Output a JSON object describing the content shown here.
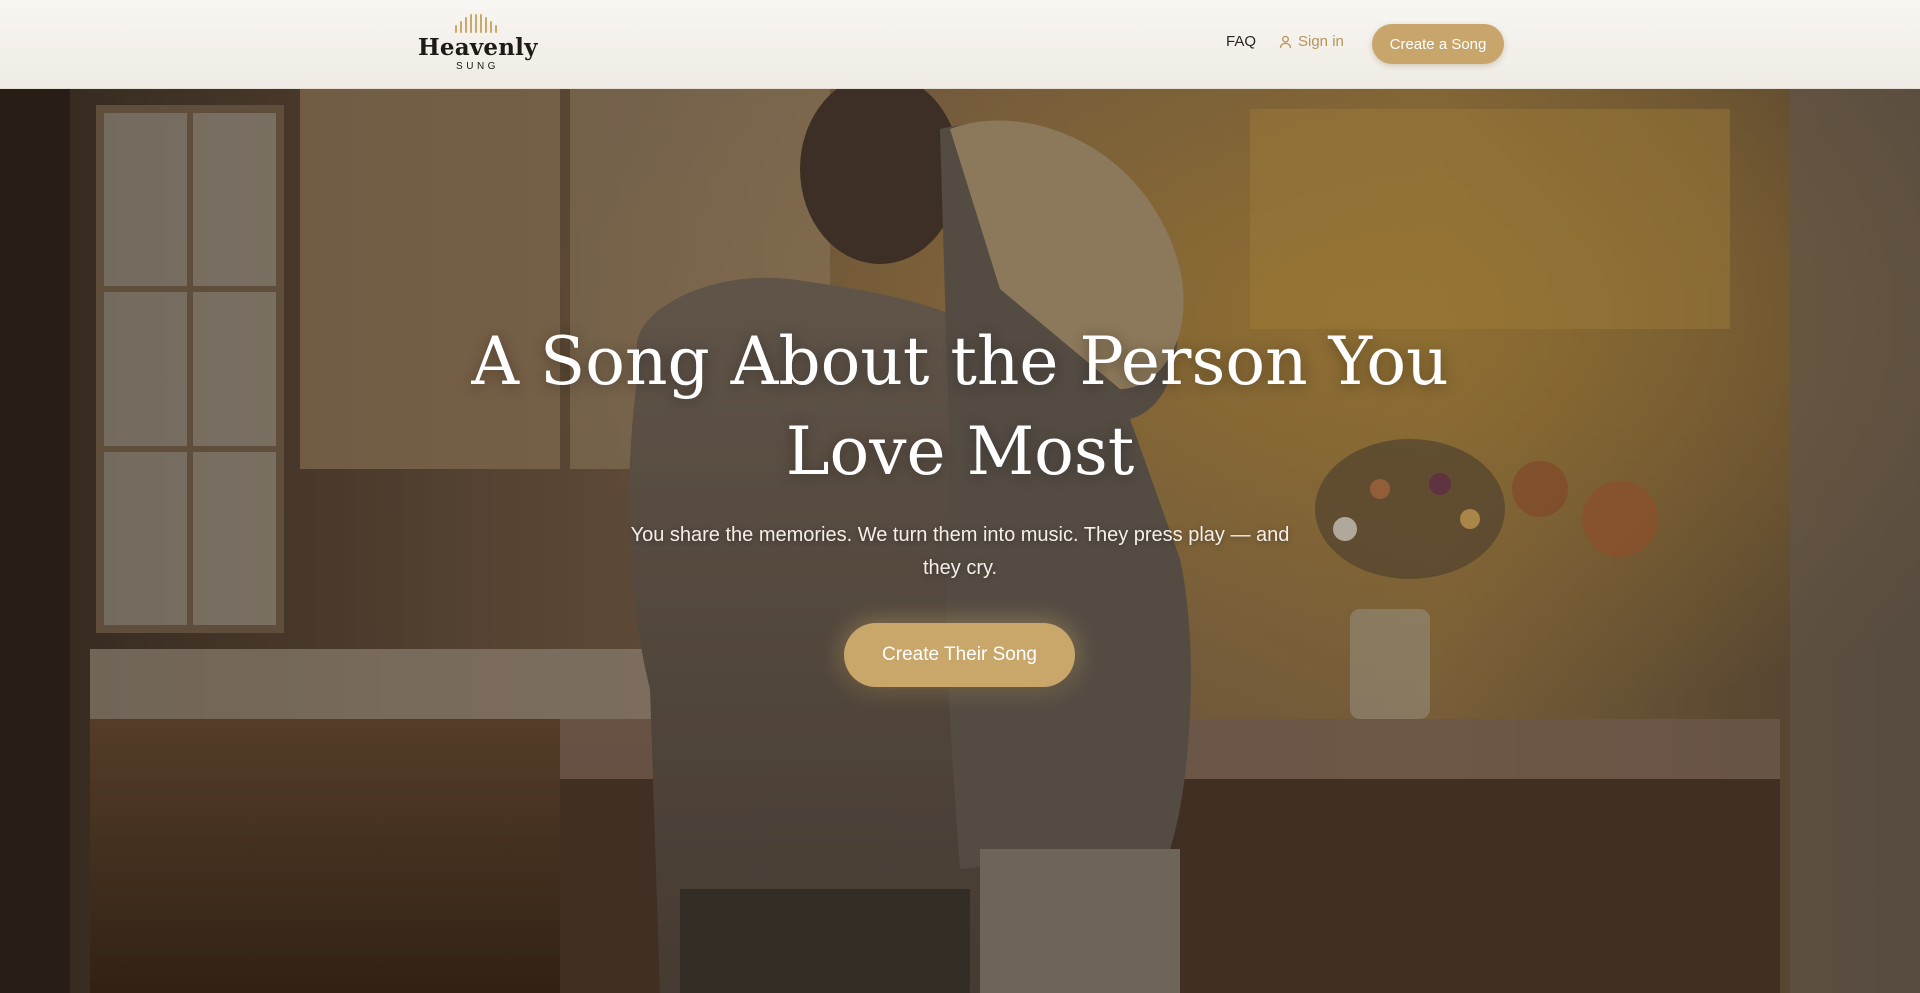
{
  "brand": {
    "name": "Heavenly",
    "tagline": "SUNG",
    "accent_color": "#c8a56a"
  },
  "nav": {
    "faq_label": "FAQ",
    "signin_label": "Sign in",
    "signin_icon": "user-icon",
    "create_label": "Create a Song"
  },
  "hero": {
    "title": "A Song About the Person You Love Most",
    "subtitle": "You share the memories. We turn them into music. They press play — and they cry.",
    "cta_label": "Create Their Song"
  }
}
